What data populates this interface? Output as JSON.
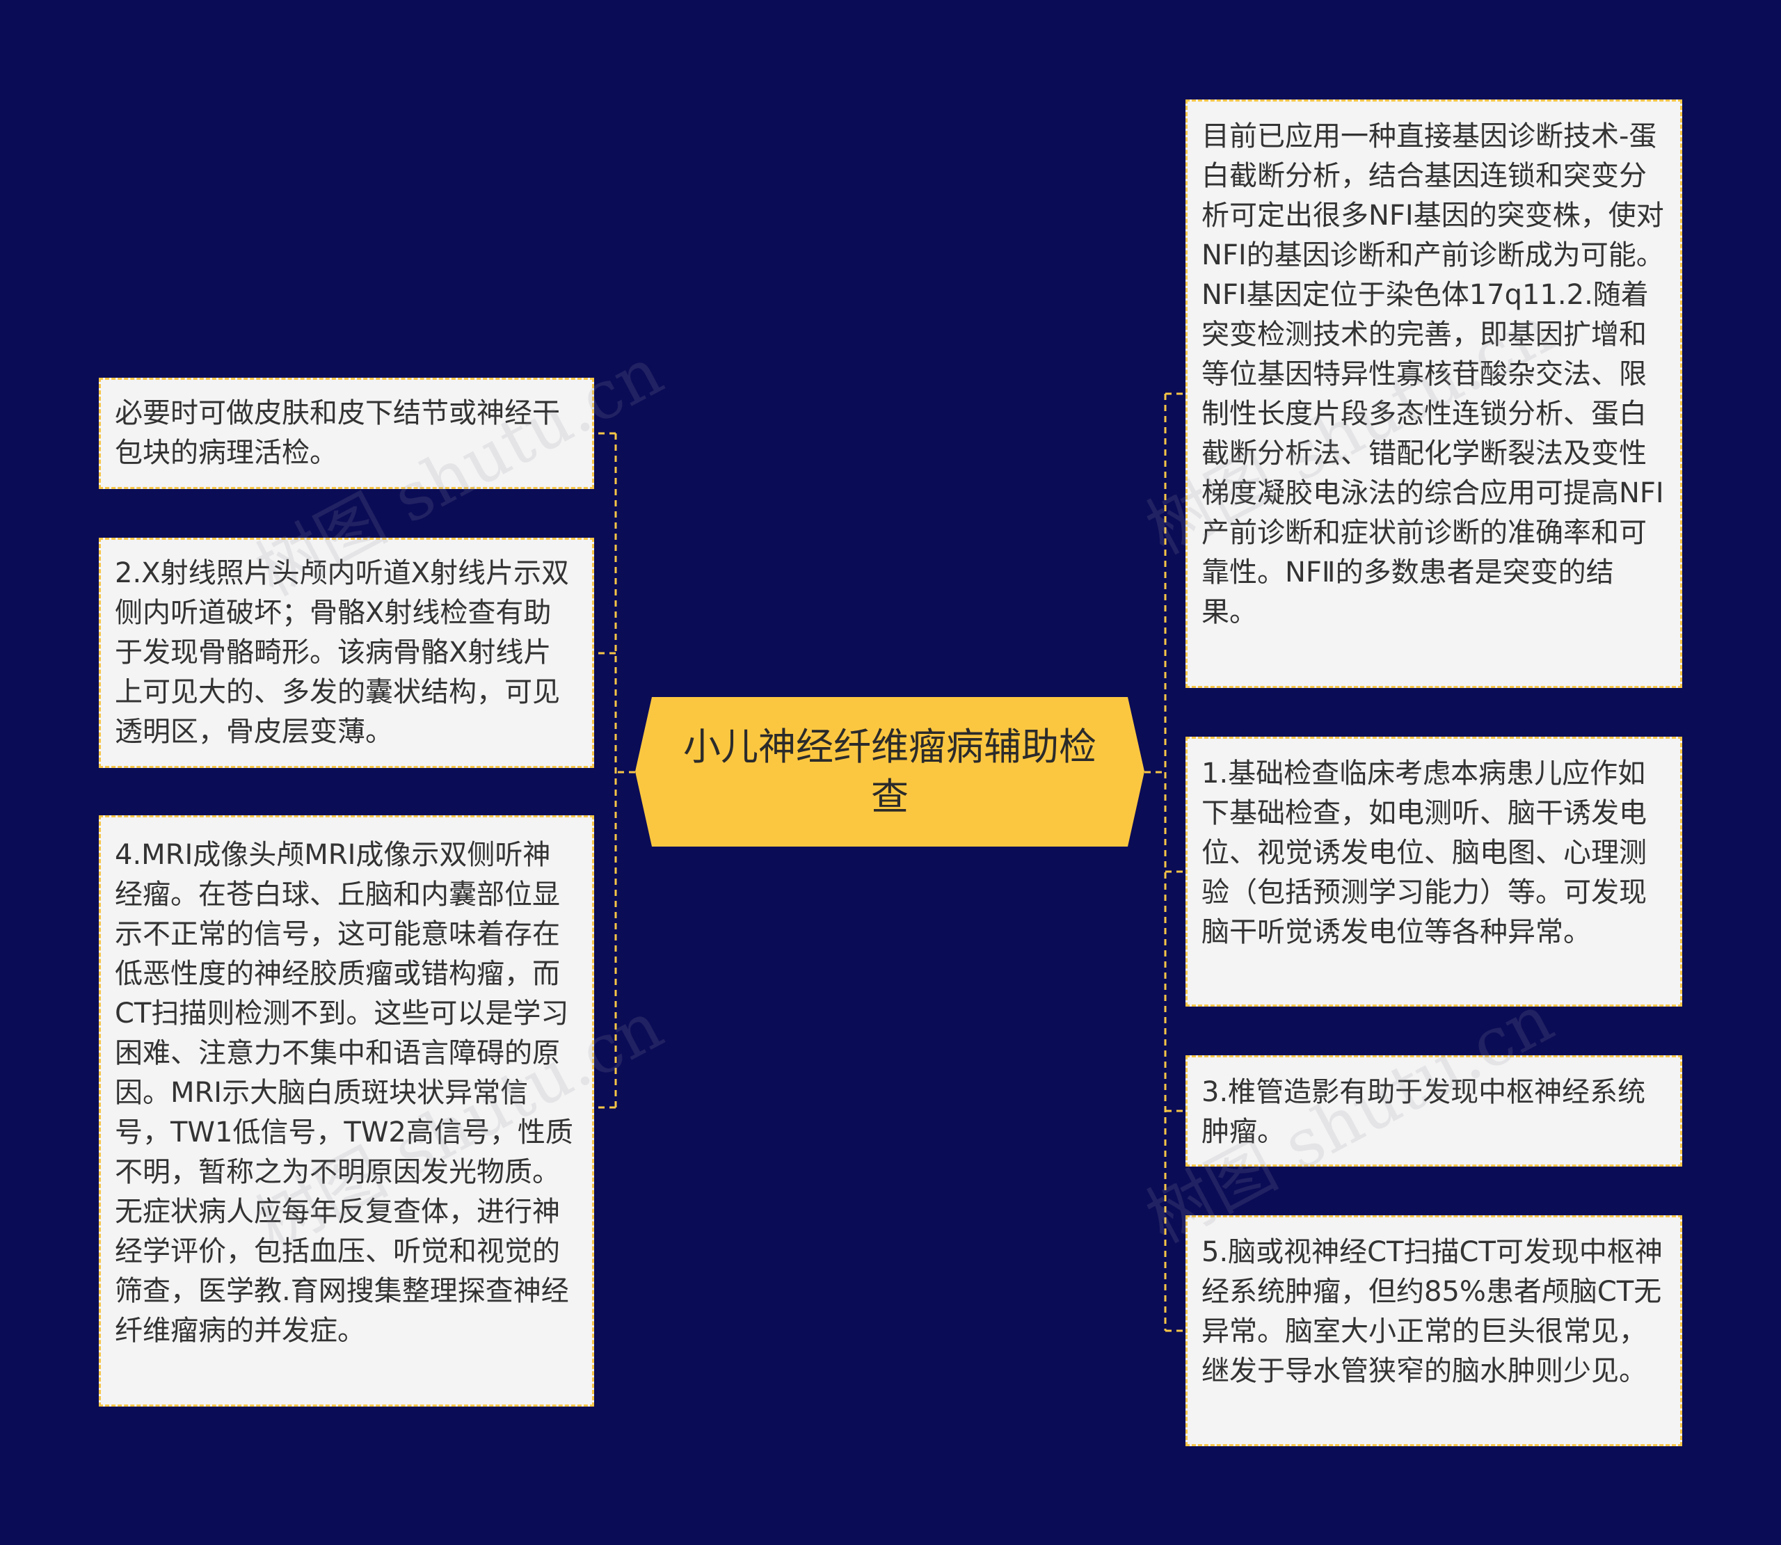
{
  "root": {
    "title": "小儿神经纤维瘤病辅助检查"
  },
  "left_nodes": [
    {
      "text": "必要时可做皮肤和皮下结节或神经干包块的病理活检。"
    },
    {
      "text": "2.X射线照片头颅内听道X射线片示双侧内听道破坏；骨骼X射线检查有助于发现骨骼畸形。该病骨骼X射线片上可见大的、多发的囊状结构，可见透明区，骨皮层变薄。"
    },
    {
      "text": "4.MRI成像头颅MRI成像示双侧听神经瘤。在苍白球、丘脑和内囊部位显示不正常的信号，这可能意味着存在低恶性度的神经胶质瘤或错构瘤，而CT扫描则检测不到。这些可以是学习困难、注意力不集中和语言障碍的原因。MRI示大脑白质斑块状异常信号，TW1低信号，TW2高信号，性质不明，暂称之为不明原因发光物质。无症状病人应每年反复查体，进行神经学评价，包括血压、听觉和视觉的筛查，医学教.育网搜集整理探查神经纤维瘤病的并发症。"
    }
  ],
  "right_nodes": [
    {
      "text": "目前已应用一种直接基因诊断技术-蛋白截断分析，结合基因连锁和突变分析可定出很多NFⅠ基因的突变株，使对NFⅠ的基因诊断和产前诊断成为可能。NFⅠ基因定位于染色体17q11.2.随着突变检测技术的完善，即基因扩增和等位基因特异性寡核苷酸杂交法、限制性长度片段多态性连锁分析、蛋白截断分析法、错配化学断裂法及变性梯度凝胶电泳法的综合应用可提高NFⅠ产前诊断和症状前诊断的准确率和可靠性。NFⅡ的多数患者是突变的结果。"
    },
    {
      "text": "1.基础检查临床考虑本病患儿应作如下基础检查，如电测听、脑干诱发电位、视觉诱发电位、脑电图、心理测验（包括预测学习能力）等。可发现脑干听觉诱发电位等各种异常。"
    },
    {
      "text": "3.椎管造影有助于发现中枢神经系统肿瘤。"
    },
    {
      "text": "5.脑或视神经CT扫描CT可发现中枢神经系统肿瘤，但约85%患者颅脑CT无异常。脑室大小正常的巨头很常见，继发于导水管狭窄的脑水肿则少见。"
    }
  ],
  "watermark": {
    "text": "树图 shutu.cn"
  },
  "colors": {
    "background": "#0b0c56",
    "root_fill": "#fcc740",
    "card_fill": "#f4f4f4",
    "connector": "#f7c646",
    "text": "#333333"
  }
}
